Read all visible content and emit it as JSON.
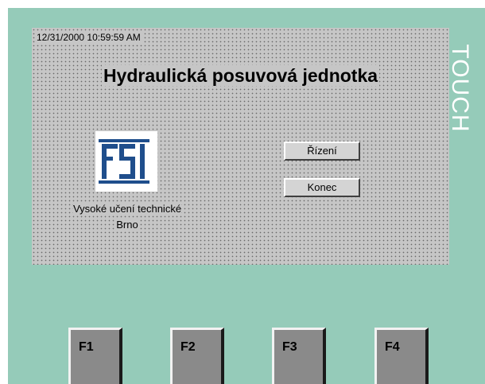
{
  "screen": {
    "datetime": "12/31/2000 10:59:59 AM",
    "title": "Hydraulická posuvová jednotka",
    "logo_text": "FSI",
    "school_line1": "Vysoké učení technické",
    "school_line2": "Brno",
    "buttons": {
      "rizeni": "Řízení",
      "konec": "Konec"
    }
  },
  "brand": "TOUCH",
  "function_keys": [
    "F1",
    "F2",
    "F3",
    "F4"
  ],
  "colors": {
    "bezel": "#95cbb9",
    "screen": "#c6c6c6",
    "logo_blue": "#1f4e8c",
    "function_key": "#8a8a8a"
  }
}
